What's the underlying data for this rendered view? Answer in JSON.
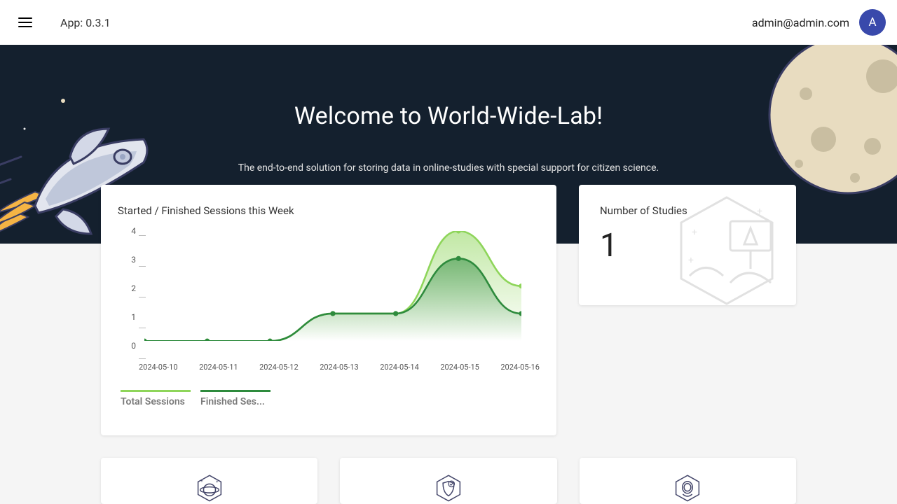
{
  "header": {
    "version": "App: 0.3.1",
    "user_email": "admin@admin.com",
    "avatar_letter": "A"
  },
  "hero": {
    "title": "Welcome to World-Wide-Lab!",
    "subtitle": "The end-to-end solution for storing data in online-studies with special support for citizen science."
  },
  "chart_card": {
    "title": "Started / Finished Sessions this Week"
  },
  "chart_data": {
    "type": "line",
    "categories": [
      "2024-05-10",
      "2024-05-11",
      "2024-05-12",
      "2024-05-13",
      "2024-05-14",
      "2024-05-15",
      "2024-05-16"
    ],
    "series": [
      {
        "name": "Total Sessions",
        "values": [
          0,
          0,
          0,
          1,
          1,
          4,
          2
        ]
      },
      {
        "name": "Finished Ses...",
        "values": [
          0,
          0,
          0,
          1,
          1,
          3,
          1
        ]
      }
    ],
    "ylim": [
      0,
      4
    ],
    "yticks": [
      0,
      1,
      2,
      3,
      4
    ],
    "title": "Started / Finished Sessions this Week",
    "xlabel": "",
    "ylabel": "",
    "legend_labels": [
      "Total Sessions",
      "Finished Ses..."
    ]
  },
  "studies_card": {
    "title": "Number of Studies",
    "value": "1"
  },
  "colors": {
    "series_a": "#8ed55a",
    "series_b": "#2e8b3d",
    "hero_bg": "#14202e",
    "avatar": "#3949ab"
  }
}
